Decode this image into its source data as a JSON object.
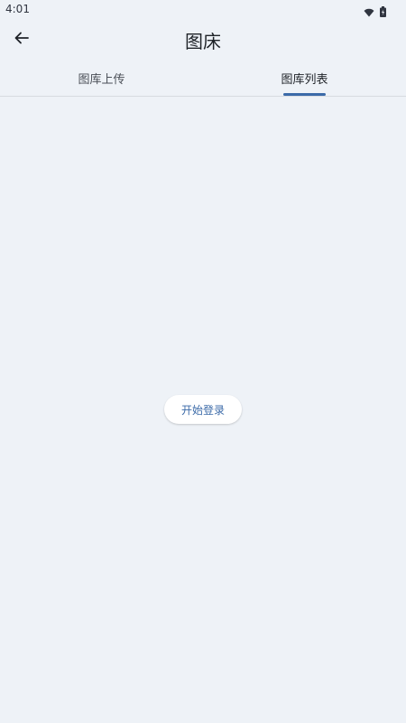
{
  "status_bar": {
    "time": "4:01",
    "icons": [
      "wifi-icon",
      "battery-icon"
    ]
  },
  "app_bar": {
    "title": "图床",
    "back_icon": "arrow-left-icon"
  },
  "tabs": [
    {
      "label": "图库上传",
      "selected": false
    },
    {
      "label": "图库列表",
      "selected": true
    }
  ],
  "content": {
    "login_button_label": "开始登录"
  },
  "colors": {
    "background": "#eef2f7",
    "accent": "#3b6aa8",
    "button_bg": "#ffffff"
  }
}
